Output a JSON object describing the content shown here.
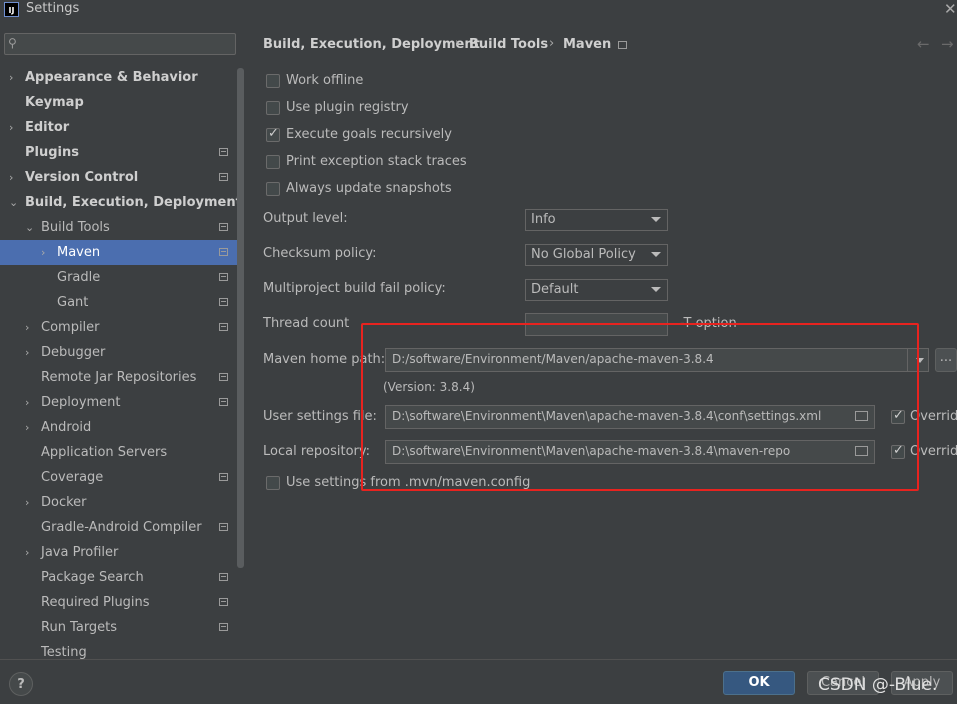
{
  "window": {
    "title": "Settings",
    "app_icon_text": "IJ"
  },
  "sidebar": {
    "items": [
      {
        "label": "Appearance & Behavior",
        "arrow": "›",
        "bold": true
      },
      {
        "label": "Keymap",
        "bold": true
      },
      {
        "label": "Editor",
        "arrow": "›",
        "bold": true
      },
      {
        "label": "Plugins",
        "bold": true
      },
      {
        "label": "Version Control",
        "arrow": "›",
        "bold": true
      },
      {
        "label": "Build, Execution, Deployment",
        "arrow": "⌄",
        "bold": true
      },
      {
        "label": "Build Tools",
        "arrow": "⌄"
      },
      {
        "label": "Maven",
        "arrow": "›",
        "selected": true
      },
      {
        "label": "Gradle"
      },
      {
        "label": "Gant"
      },
      {
        "label": "Compiler",
        "arrow": "›"
      },
      {
        "label": "Debugger",
        "arrow": "›"
      },
      {
        "label": "Remote Jar Repositories"
      },
      {
        "label": "Deployment",
        "arrow": "›"
      },
      {
        "label": "Android",
        "arrow": "›"
      },
      {
        "label": "Application Servers"
      },
      {
        "label": "Coverage"
      },
      {
        "label": "Docker",
        "arrow": "›"
      },
      {
        "label": "Gradle-Android Compiler"
      },
      {
        "label": "Java Profiler",
        "arrow": "›"
      },
      {
        "label": "Package Search"
      },
      {
        "label": "Required Plugins"
      },
      {
        "label": "Run Targets"
      },
      {
        "label": "Testing"
      }
    ]
  },
  "breadcrumb": [
    "Build, Execution, Deployment",
    "Build Tools",
    "Maven"
  ],
  "breadcrumb_separator": "›",
  "options": {
    "work_offline": {
      "label": "Work offline",
      "checked": false
    },
    "plugin_registry": {
      "label": "Use plugin registry",
      "checked": false
    },
    "goals_recursive": {
      "label": "Execute goals recursively",
      "checked": true
    },
    "stack_traces": {
      "label": "Print exception stack traces",
      "checked": false
    },
    "update_snapshots": {
      "label": "Always update snapshots",
      "checked": false
    }
  },
  "fields": {
    "output_level": {
      "label": "Output level:",
      "value": "Info"
    },
    "checksum_policy": {
      "label": "Checksum policy:",
      "value": "No Global Policy"
    },
    "fail_policy": {
      "label": "Multiproject build fail policy:",
      "value": "Default"
    },
    "thread_count": {
      "label": "Thread count",
      "value": "",
      "suffix": "-T option"
    },
    "maven_home": {
      "label": "Maven home path:",
      "value": "D:/software/Environment/Maven/apache-maven-3.8.4",
      "browse": "...",
      "version": "(Version: 3.8.4)"
    },
    "user_settings": {
      "label": "User settings file:",
      "value": "D:\\software\\Environment\\Maven\\apache-maven-3.8.4\\conf\\settings.xml",
      "override_label": "Override",
      "override_checked": true
    },
    "local_repo": {
      "label": "Local repository:",
      "value": "D:\\software\\Environment\\Maven\\apache-maven-3.8.4\\maven-repo",
      "override_label": "Override",
      "override_checked": true
    },
    "mvn_config": {
      "label": "Use settings from .mvn/maven.config",
      "checked": false
    }
  },
  "buttons": {
    "ok": "OK",
    "cancel": "Cancel",
    "apply": "Apply",
    "help": "?"
  },
  "watermark": "CSDN @-Blue.",
  "colors": {
    "selection": "#4b6eaf",
    "highlight_box": "#e8231f",
    "primary_button": "#365880"
  }
}
